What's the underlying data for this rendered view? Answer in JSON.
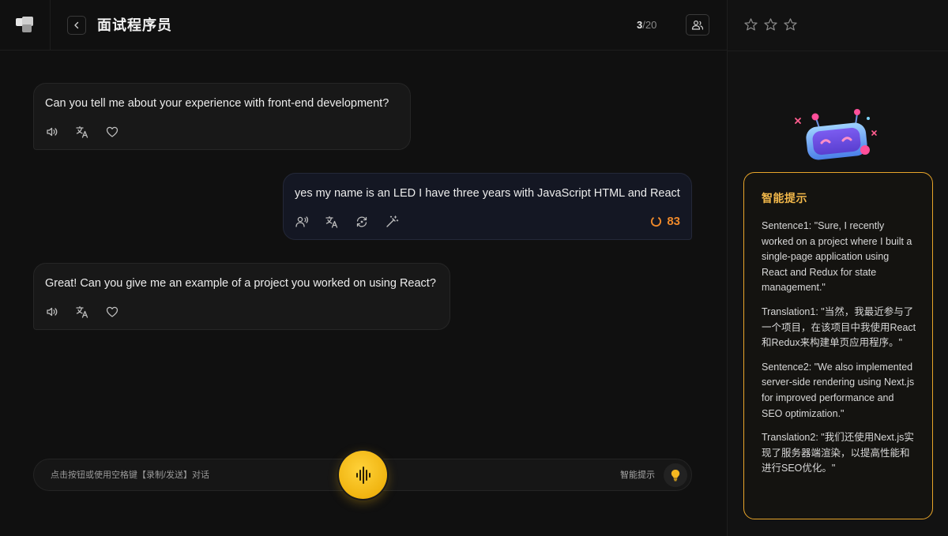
{
  "header": {
    "title": "面试程序员",
    "progress_current": "3",
    "progress_total": "/20"
  },
  "messages": [
    {
      "role": "ai",
      "text": "Can you tell me about your experience with front-end development?"
    },
    {
      "role": "user",
      "text": "yes my name is an LED I have three years with JavaScript HTML and React",
      "score": "83"
    },
    {
      "role": "ai",
      "text": "Great! Can you give me an example of a project you worked on using React?"
    }
  ],
  "rating": {
    "stars_total": 3,
    "stars_filled": 0
  },
  "hint_panel": {
    "title": "智能提示",
    "paragraphs": [
      "Sentence1: \"Sure, I recently worked on a project where I built a single-page application using React and Redux for state management.\"",
      "Translation1: \"当然，我最近参与了一个项目，在该项目中我使用React和Redux来构建单页应用程序。\"",
      "Sentence2: \"We also implemented server-side rendering using Next.js for improved performance and SEO optimization.\"",
      "Translation2: \"我们还使用Next.js实现了服务器端渲染，以提高性能和进行SEO优化。\""
    ]
  },
  "input_bar": {
    "hint": "点击按钮或使用空格键【录制/发送】对话",
    "smart_hint_label": "智能提示"
  },
  "colors": {
    "accent": "#f0b410",
    "score": "#f08a2a",
    "hint_border": "#e8a52a"
  }
}
